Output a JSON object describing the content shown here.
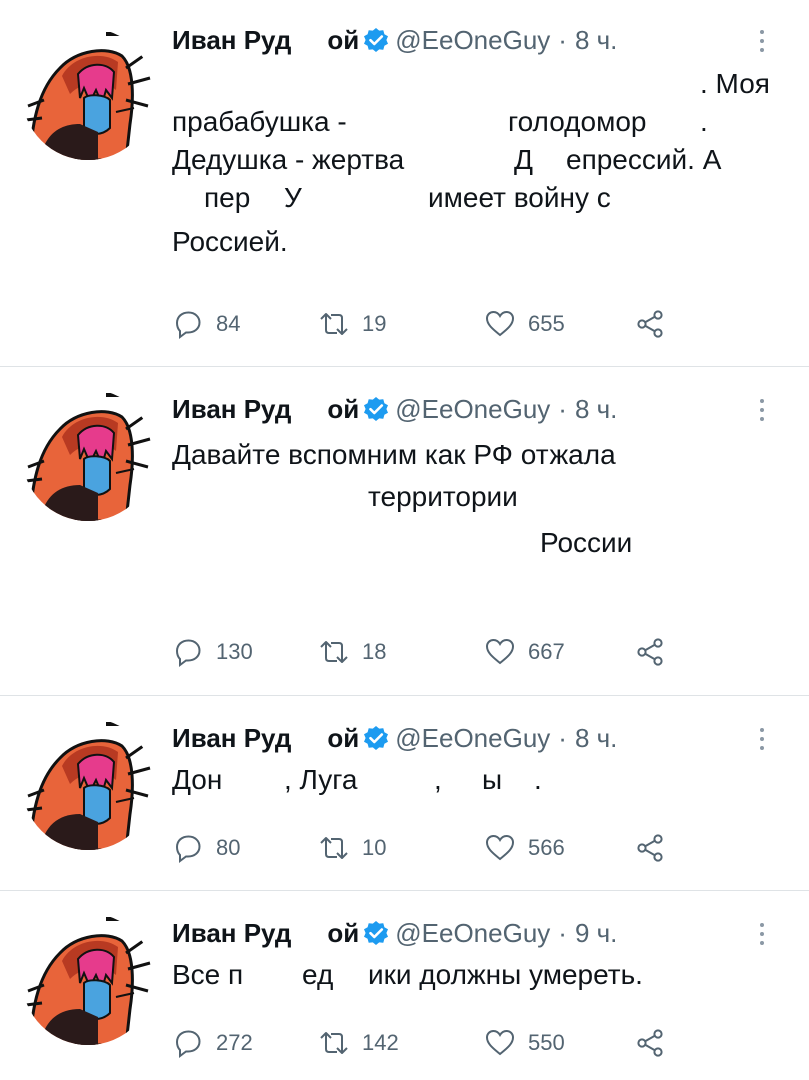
{
  "author": {
    "name_part1": "Иван Руд",
    "name_part2": "ой",
    "handle": "@EeOneGuy",
    "verified_color": "#1d9bf0"
  },
  "tweets": [
    {
      "time": "8 ч.",
      "line1": ". Моя",
      "line2a": "прабабушка -",
      "line2b": "голодомор",
      "line2c": ".",
      "line3a": "Дедушка - жертва",
      "line3b": "Д",
      "line3c": "епрессий. А",
      "line4a": "пер",
      "line4b": "У",
      "line4c": "имеет войну с",
      "line5": "Россией.",
      "replies": "84",
      "retweets": "19",
      "likes": "655"
    },
    {
      "time": "8 ч.",
      "line1": "Давайте вспомним как РФ отжала",
      "line2": "территории",
      "line3": "России",
      "replies": "130",
      "retweets": "18",
      "likes": "667"
    },
    {
      "time": "8 ч.",
      "line1a": "Дон",
      "line1b": ", Луга",
      "line1c": ",",
      "line1d": "ы",
      "line1e": ".",
      "replies": "80",
      "retweets": "10",
      "likes": "566"
    },
    {
      "time": "9 ч.",
      "line1a": "Все п",
      "line1b": "ед",
      "line1c": "ики должны умереть.",
      "replies": "272",
      "retweets": "142",
      "likes": "550"
    }
  ],
  "icons": {
    "reply": "reply-icon",
    "retweet": "retweet-icon",
    "like": "heart-icon",
    "share": "share-icon",
    "more": "more-icon"
  },
  "colors": {
    "text": "#0f1419",
    "muted": "#536471",
    "divider": "#dfe3e6",
    "avatar_hood": "#e8643a",
    "avatar_hair": "#e63b8c",
    "avatar_face": "#4aa3df"
  }
}
